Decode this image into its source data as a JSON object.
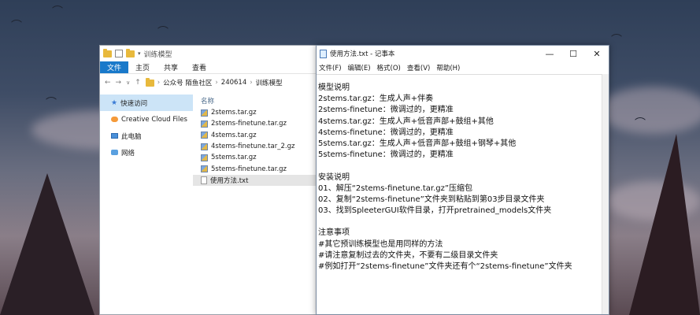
{
  "explorer": {
    "title": "训练模型",
    "ribbon_tabs": [
      "文件",
      "主页",
      "共享",
      "查看"
    ],
    "address": {
      "crumbs": [
        "公众号 陌鱼社区",
        "240614",
        "训练模型"
      ]
    },
    "nav_items": [
      {
        "label": "快速访问",
        "icon": "star-icon"
      },
      {
        "label": "Creative Cloud Files",
        "icon": "creative-cloud-icon"
      },
      {
        "label": "此电脑",
        "icon": "pc-icon"
      },
      {
        "label": "网络",
        "icon": "network-icon"
      }
    ],
    "column_header": "名称",
    "files": [
      {
        "name": "2stems.tar.gz",
        "type": "gz"
      },
      {
        "name": "2stems-finetune.tar.gz",
        "type": "gz"
      },
      {
        "name": "4stems.tar.gz",
        "type": "gz"
      },
      {
        "name": "4stems-finetune.tar_2.gz",
        "type": "gz"
      },
      {
        "name": "5stems.tar.gz",
        "type": "gz"
      },
      {
        "name": "5stems-finetune.tar.gz",
        "type": "gz"
      },
      {
        "name": "使用方法.txt",
        "type": "txt"
      }
    ]
  },
  "notepad": {
    "title": "使用方法.txt - 记事本",
    "menu": [
      "文件(F)",
      "编辑(E)",
      "格式(O)",
      "查看(V)",
      "帮助(H)"
    ],
    "lines": [
      "模型说明",
      "2stems.tar.gz：生成人声+伴奏",
      "2stems-finetune：微调过的，更精准",
      "4stems.tar.gz：生成人声+低音声部+鼓组+其他",
      "4stems-finetune：微调过的，更精准",
      "5stems.tar.gz：生成人声+低音声部+鼓组+钢琴+其他",
      "5stems-finetune：微调过的，更精准",
      "",
      "安装说明",
      "01、解压“2stems-finetune.tar.gz”压缩包",
      "02、复制“2stems-finetune”文件夹到粘贴到第03步目录文件夹",
      "03、找到SpleeterGUI软件目录，打开pretrained_models文件夹",
      "",
      "注意事项",
      "#其它预训练模型也是用同样的方法",
      "#请注意复制过去的文件夹，不要有二级目录文件夹",
      "#例如打开“2stems-finetune”文件夹还有个“2stems-finetune”文件夹"
    ]
  }
}
